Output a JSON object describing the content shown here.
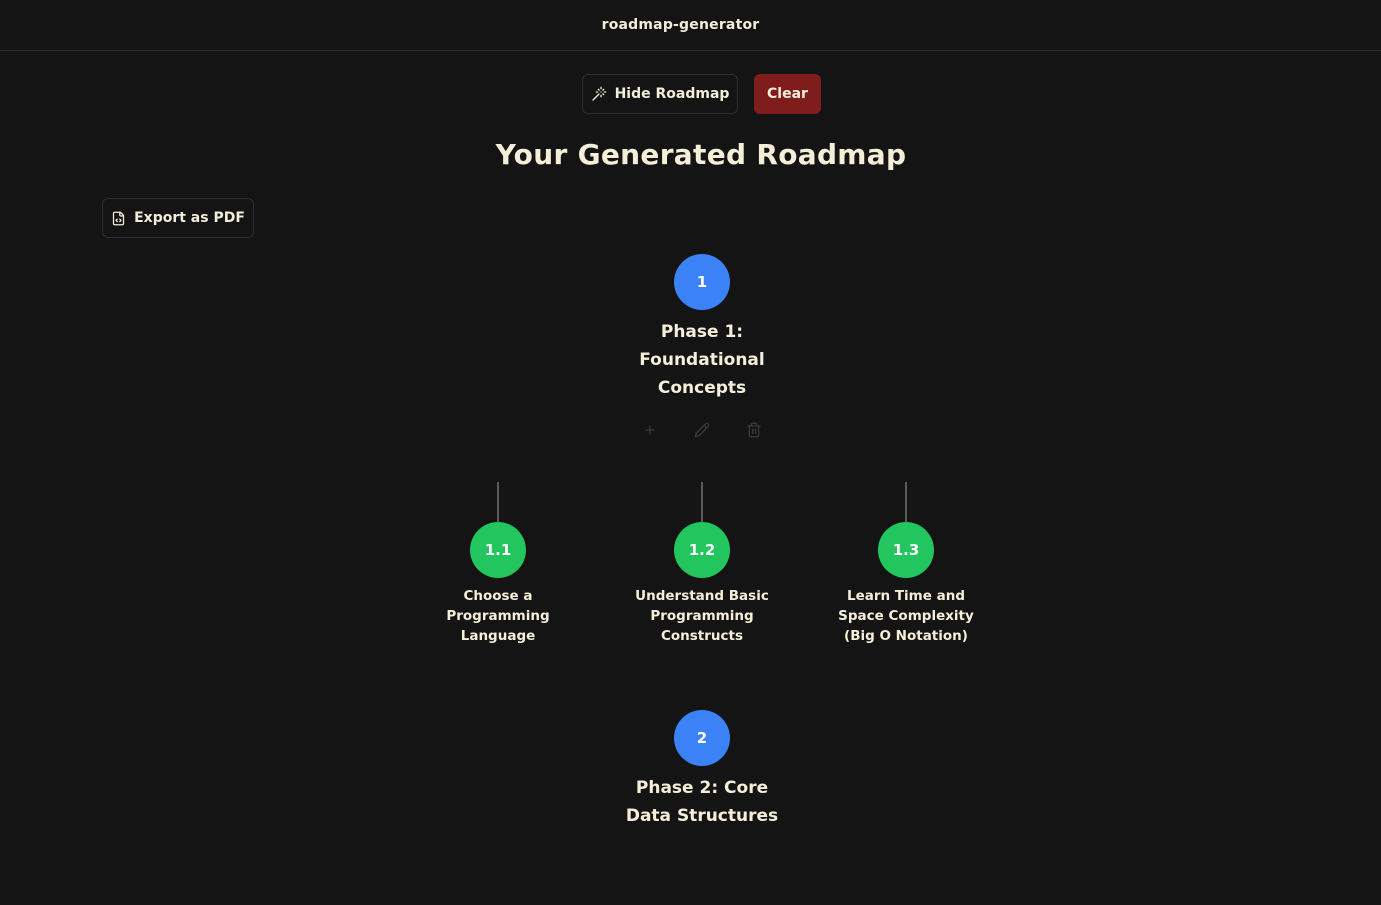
{
  "app": {
    "title": "roadmap-generator"
  },
  "toolbar": {
    "hide_label": "Hide Roadmap",
    "clear_label": "Clear"
  },
  "page": {
    "title": "Your Generated Roadmap",
    "export_label": "Export as PDF"
  },
  "phases": [
    {
      "number": "1",
      "title": "Phase 1: Foundational Concepts",
      "actions": [
        "plus-icon",
        "pencil-icon",
        "trash-icon"
      ],
      "subtopics": [
        {
          "number": "1.1",
          "label": "Choose a Programming Language"
        },
        {
          "number": "1.2",
          "label": "Understand Basic Programming Constructs"
        },
        {
          "number": "1.3",
          "label": "Learn Time and Space Complexity (Big O Notation)"
        }
      ]
    },
    {
      "number": "2",
      "title": "Phase 2: Core Data Structures"
    }
  ],
  "colors": {
    "background": "#141414",
    "phase_node": "#3b82f6",
    "subtopic_node": "#22c55e",
    "clear_button": "#7f1d1d",
    "text": "#f5efda"
  },
  "icons": {
    "hide_button": "wand-icon",
    "export_button": "file-code-icon"
  }
}
